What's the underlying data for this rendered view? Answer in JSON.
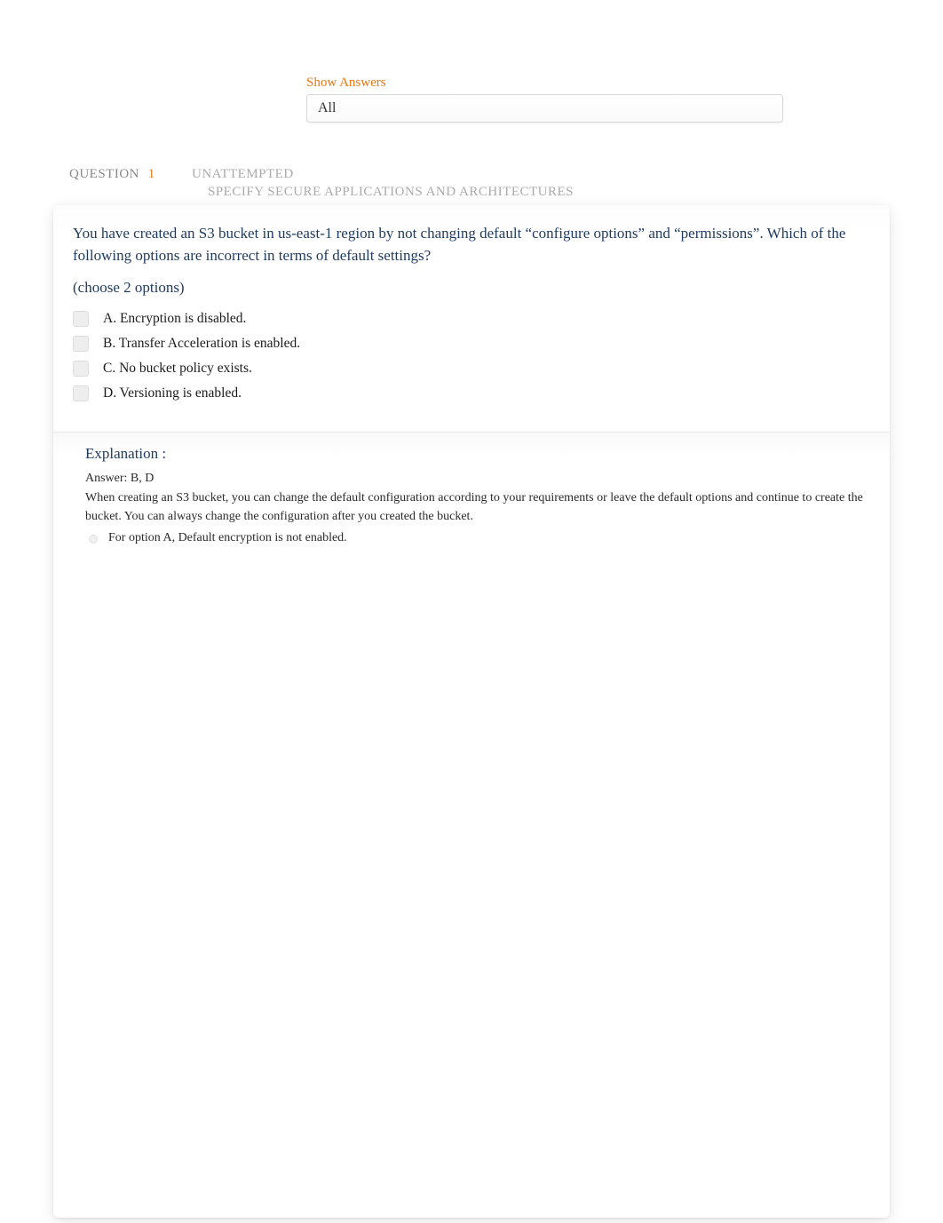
{
  "filter": {
    "label": "Show Answers",
    "selected": "All"
  },
  "meta": {
    "question_label": "QUESTION",
    "question_number": "1",
    "status": "UNATTEMPTED",
    "category": "SPECIFY SECURE APPLICATIONS AND ARCHITECTURES"
  },
  "question": {
    "text": "You have created an S3 bucket in us-east-1 region by not changing default “configure options” and “permissions”. Which of the following options are incorrect in terms of default settings?",
    "hint": "(choose 2 options)",
    "options": [
      "A. Encryption is disabled.",
      "B. Transfer Acceleration is enabled.",
      "C. No bucket policy exists.",
      "D. Versioning is enabled."
    ]
  },
  "explanation": {
    "title": "Explanation :",
    "answer_line": "Answer: B, D",
    "paragraph": "When creating an S3 bucket, you can change the default configuration according to your requirements or leave the default options and continue to create the bucket. You can always change the configuration after you created the bucket.",
    "bullet": "For option A, Default encryption is not enabled."
  }
}
